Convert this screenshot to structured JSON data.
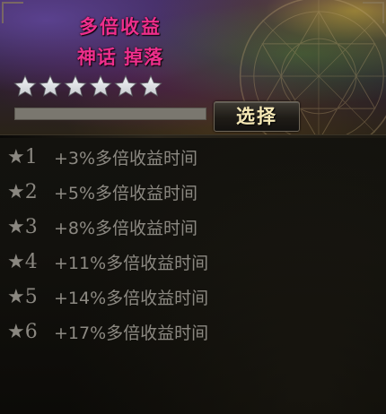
{
  "header": {
    "title": "多倍收益",
    "subtitle": "神话  掉落",
    "star_rating": {
      "filled": 0,
      "total": 6
    },
    "progress": 0,
    "select_label": "选择"
  },
  "bonus_list": [
    {
      "level": "★1",
      "text": "+3%多倍收益时间"
    },
    {
      "level": "★2",
      "text": "+5%多倍收益时间"
    },
    {
      "level": "★3",
      "text": "+8%多倍收益时间"
    },
    {
      "level": "★4",
      "text": "+11%多倍收益时间"
    },
    {
      "level": "★5",
      "text": "+14%多倍收益时间"
    },
    {
      "level": "★6",
      "text": "+17%多倍收益时间"
    }
  ],
  "colors": {
    "title": "#ee2f8c",
    "list_text": "#8c8982",
    "button_text": "#f7e9b6",
    "star_empty": "#c9ccd1"
  }
}
